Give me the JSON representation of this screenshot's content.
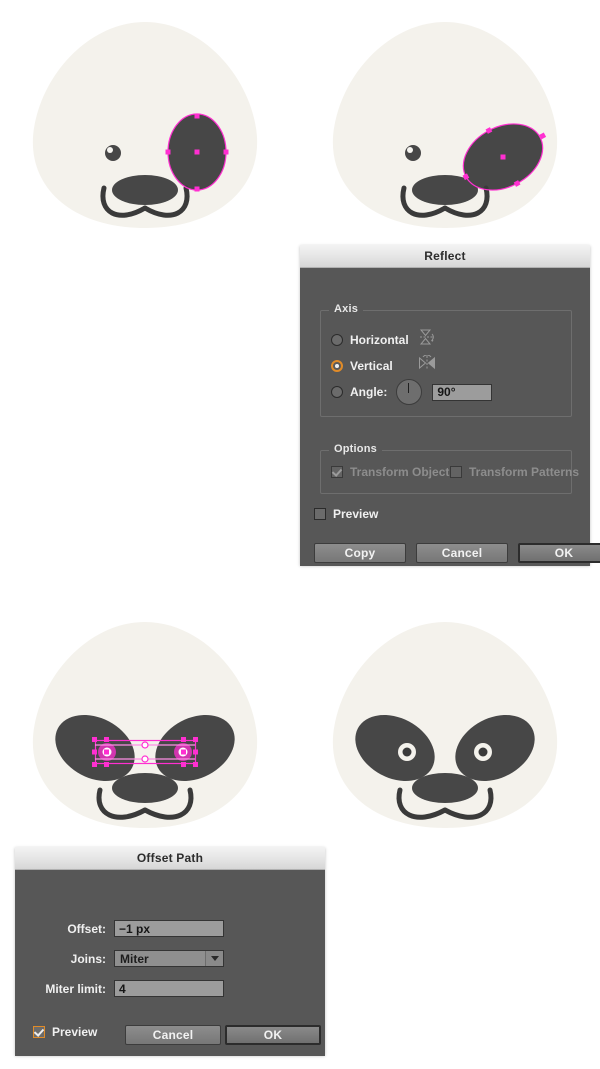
{
  "illustration": {
    "face_color": "#F4F2EC",
    "patch_color": "#474747",
    "stroke_color": "#3A3A3A",
    "selection_color": "#FF2FD1",
    "panels": [
      {
        "name": "panel-one-eye-patch-selected",
        "caption": ""
      },
      {
        "name": "panel-eye-patch-rotated",
        "caption": ""
      },
      {
        "name": "panel-both-eyes-selected",
        "caption": ""
      },
      {
        "name": "panel-final-panda-face",
        "caption": ""
      }
    ]
  },
  "reflect_dialog": {
    "title": "Reflect",
    "axis_group": {
      "legend": "Axis",
      "options": [
        {
          "label": "Horizontal",
          "selected": false,
          "icon": "reflect-horizontal-icon"
        },
        {
          "label": "Vertical",
          "selected": true,
          "icon": "reflect-vertical-icon"
        },
        {
          "label": "Angle:",
          "selected": false,
          "icon": "angle-dial-icon"
        }
      ],
      "angle_value": "90°"
    },
    "options_group": {
      "legend": "Options",
      "transform_objects": {
        "label": "Transform Objects",
        "checked": true,
        "enabled": false
      },
      "transform_patterns": {
        "label": "Transform Patterns",
        "checked": false,
        "enabled": false
      }
    },
    "preview": {
      "label": "Preview",
      "checked": false
    },
    "buttons": {
      "copy": "Copy",
      "cancel": "Cancel",
      "ok": "OK"
    }
  },
  "offset_path_dialog": {
    "title": "Offset Path",
    "fields": {
      "offset": {
        "label": "Offset:",
        "value": "−1 px"
      },
      "joins": {
        "label": "Joins:",
        "value": "Miter"
      },
      "miter_limit": {
        "label": "Miter limit:",
        "value": "4"
      }
    },
    "preview": {
      "label": "Preview",
      "checked": true
    },
    "buttons": {
      "cancel": "Cancel",
      "ok": "OK"
    }
  }
}
